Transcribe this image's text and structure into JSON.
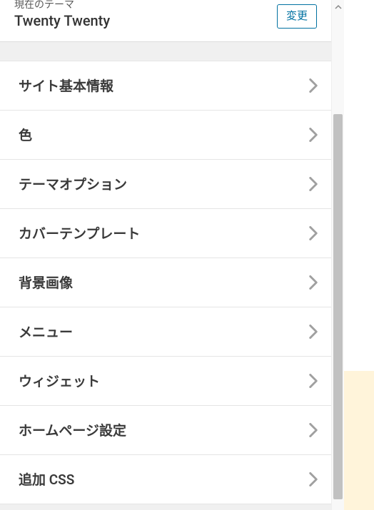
{
  "header": {
    "current_theme_label": "現在のテーマ",
    "theme_name": "Twenty Twenty",
    "change_button": "変更"
  },
  "sections": [
    {
      "label": "サイト基本情報"
    },
    {
      "label": "色"
    },
    {
      "label": "テーマオプション"
    },
    {
      "label": "カバーテンプレート"
    },
    {
      "label": "背景画像"
    },
    {
      "label": "メニュー"
    },
    {
      "label": "ウィジェット"
    },
    {
      "label": "ホームページ設定"
    },
    {
      "label": "追加 CSS"
    }
  ]
}
